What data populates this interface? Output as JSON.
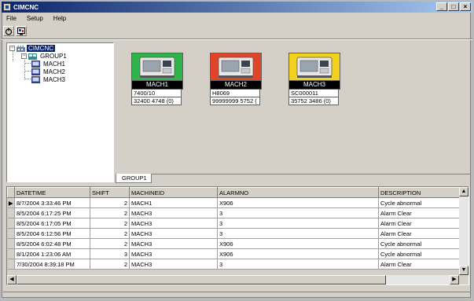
{
  "window": {
    "title": "CIMCNC",
    "minimize": "_",
    "maximize": "□",
    "close": "×"
  },
  "menu": [
    "File",
    "Setup",
    "Help"
  ],
  "tree": {
    "root": "CIMCNC",
    "group": "GROUP1",
    "machines": [
      "MACH1",
      "MACH2",
      "MACH3"
    ]
  },
  "machines": [
    {
      "name": "MACH1",
      "status_color": "#2fb34a",
      "program": "7400/10",
      "counter": "32400 4748 (0)"
    },
    {
      "name": "MACH2",
      "status_color": "#e0452a",
      "program": "H8069",
      "counter": "99999999 5752 ("
    },
    {
      "name": "MACH3",
      "status_color": "#f2d21f",
      "program": "SC000011",
      "counter": "35752 3486 (0)"
    }
  ],
  "tab": "GROUP1",
  "alarms": {
    "columns": [
      "DATETIME",
      "SHIFT",
      "MACHINEID",
      "ALARMNO",
      "DESCRIPTION"
    ],
    "rows": [
      [
        "8/7/2004 3:33:46 PM",
        "2",
        "MACH1",
        "X906",
        "Cycle abnormal"
      ],
      [
        "8/5/2004 6:17:25 PM",
        "2",
        "MACH3",
        "3",
        "Alarm Clear"
      ],
      [
        "8/5/2004 6:17:05 PM",
        "2",
        "MACH3",
        "3",
        "Alarm Clear"
      ],
      [
        "8/5/2004 6:12:56 PM",
        "2",
        "MACH3",
        "3",
        "Alarm Clear"
      ],
      [
        "8/5/2004 6:02:48 PM",
        "2",
        "MACH3",
        "X906",
        "Cycle abnormal"
      ],
      [
        "8/1/2004 1:23:06 AM",
        "3",
        "MACH3",
        "X906",
        "Cycle abnormal"
      ],
      [
        "7/30/2004 8:39:18 PM",
        "2",
        "MACH3",
        "3",
        "Alarm Clear"
      ]
    ]
  }
}
